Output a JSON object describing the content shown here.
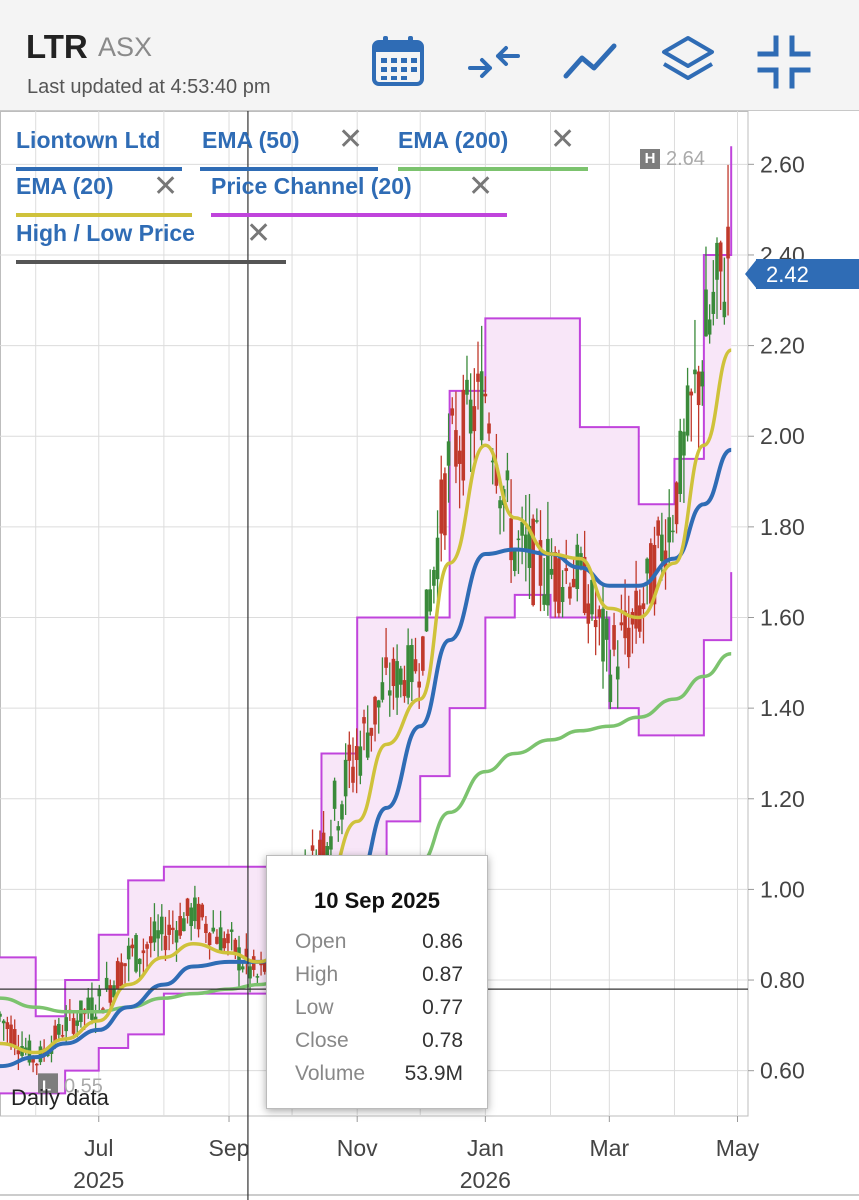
{
  "header": {
    "symbol": "LTR",
    "exchange": "ASX",
    "last_updated": "Last updated at 4:53:40 pm",
    "toolbar": [
      {
        "icon": "calendar-icon"
      },
      {
        "icon": "compare-arrows-icon"
      },
      {
        "icon": "line-chart-icon"
      },
      {
        "icon": "layers-icon"
      },
      {
        "icon": "collapse-icon"
      }
    ]
  },
  "legend": {
    "items": [
      {
        "label": "Liontown Ltd",
        "color": "#2f6cb5",
        "closable": false
      },
      {
        "label": "EMA (50)",
        "color": "#2f6cb5",
        "closable": true
      },
      {
        "label": "EMA (200)",
        "color": "#7cc36e",
        "closable": true
      },
      {
        "label": "EMA (20)",
        "color": "#cfc23b",
        "closable": true
      },
      {
        "label": "Price Channel (20)",
        "color": "#c044dc",
        "closable": true
      },
      {
        "label": "High / Low Price",
        "color": "#555555",
        "closable": true
      }
    ],
    "close_glyph": "✕"
  },
  "markers": {
    "high_badge": "H",
    "high_value": "2.64",
    "low_value": "0.55",
    "current_price": "2.42",
    "daily_label": "Daily data"
  },
  "tooltip": {
    "date": "10 Sep 2025",
    "rows": [
      {
        "label": "Open",
        "value": "0.86"
      },
      {
        "label": "High",
        "value": "0.87"
      },
      {
        "label": "Low",
        "value": "0.77"
      },
      {
        "label": "Close",
        "value": "0.78"
      },
      {
        "label": "Volume",
        "value": "53.9M"
      }
    ]
  },
  "colors": {
    "ema50": "#2f6cb5",
    "ema200": "#7cc36e",
    "ema20": "#cfc23b",
    "channel": "#c044dc",
    "channel_fill": "#f8e6f8",
    "up_candle": "#3a8a3a",
    "down_candle": "#c0392b",
    "price_tag": "#2f6cb5"
  },
  "chart_data": {
    "type": "line",
    "title": "Liontown Ltd",
    "ylim": [
      0.5,
      2.7
    ],
    "y_ticks": [
      "2.60",
      "2.40",
      "2.20",
      "2.00",
      "1.80",
      "1.60",
      "1.40",
      "1.20",
      "1.00",
      "0.80",
      "0.60"
    ],
    "x_tick_labels": [
      {
        "date": "2025-07-01",
        "label": "Jul",
        "sub": "2025"
      },
      {
        "date": "2025-09-01",
        "label": "Sep",
        "sub": ""
      },
      {
        "date": "2025-11-01",
        "label": "Nov",
        "sub": ""
      },
      {
        "date": "2026-01-01",
        "label": "Jan",
        "sub": "2026"
      },
      {
        "date": "2026-03-01",
        "label": "Mar",
        "sub": ""
      },
      {
        "date": "2026-05-01",
        "label": "May",
        "sub": ""
      }
    ],
    "x": [
      "2025-05-15",
      "2025-06-01",
      "2025-06-15",
      "2025-07-01",
      "2025-07-15",
      "2025-08-01",
      "2025-08-15",
      "2025-09-01",
      "2025-09-15",
      "2025-10-01",
      "2025-10-15",
      "2025-11-01",
      "2025-11-15",
      "2025-12-01",
      "2025-12-15",
      "2026-01-01",
      "2026-01-15",
      "2026-02-01",
      "2026-02-15",
      "2026-03-01",
      "2026-03-15",
      "2026-04-01",
      "2026-04-15",
      "2026-04-28"
    ],
    "series": [
      {
        "name": "Liontown Ltd",
        "values": [
          0.72,
          0.62,
          0.7,
          0.75,
          0.85,
          0.9,
          0.95,
          0.88,
          0.8,
          0.95,
          1.1,
          1.3,
          1.45,
          1.5,
          1.95,
          2.1,
          1.75,
          1.7,
          1.7,
          1.5,
          1.6,
          1.85,
          2.2,
          2.42
        ]
      },
      {
        "name": "EMA (20)",
        "values": [
          0.66,
          0.64,
          0.67,
          0.71,
          0.79,
          0.85,
          0.88,
          0.86,
          0.84,
          0.88,
          0.98,
          1.15,
          1.32,
          1.42,
          1.72,
          1.98,
          1.82,
          1.74,
          1.73,
          1.62,
          1.6,
          1.72,
          1.98,
          2.19
        ]
      },
      {
        "name": "EMA (50)",
        "values": [
          0.61,
          0.63,
          0.66,
          0.69,
          0.74,
          0.79,
          0.83,
          0.84,
          0.84,
          0.86,
          0.92,
          1.02,
          1.18,
          1.36,
          1.55,
          1.74,
          1.75,
          1.74,
          1.71,
          1.67,
          1.67,
          1.73,
          1.85,
          1.97
        ]
      },
      {
        "name": "EMA (200)",
        "values": [
          0.76,
          0.74,
          0.73,
          0.73,
          0.74,
          0.76,
          0.77,
          0.78,
          0.79,
          0.81,
          0.86,
          0.92,
          0.99,
          1.06,
          1.17,
          1.26,
          1.3,
          1.33,
          1.35,
          1.36,
          1.38,
          1.42,
          1.47,
          1.52
        ]
      },
      {
        "name": "Price Channel (20) upper",
        "values": [
          0.85,
          0.72,
          0.8,
          0.9,
          1.02,
          1.05,
          1.05,
          1.05,
          1.05,
          1.05,
          1.3,
          1.6,
          1.6,
          1.6,
          2.1,
          2.26,
          2.26,
          2.26,
          2.02,
          2.02,
          1.85,
          1.95,
          2.4,
          2.64
        ]
      },
      {
        "name": "Price Channel (20) lower",
        "values": [
          0.55,
          0.55,
          0.6,
          0.65,
          0.68,
          0.77,
          0.77,
          0.77,
          0.77,
          0.77,
          0.85,
          1.05,
          1.15,
          1.25,
          1.4,
          1.6,
          1.65,
          1.6,
          1.6,
          1.4,
          1.34,
          1.34,
          1.55,
          1.7
        ]
      }
    ],
    "crosshair": {
      "date": "2025-09-10",
      "price": 0.78
    },
    "high": 2.64,
    "low": 0.55,
    "last": 2.42,
    "grid": true,
    "legend_position": "top-left"
  }
}
